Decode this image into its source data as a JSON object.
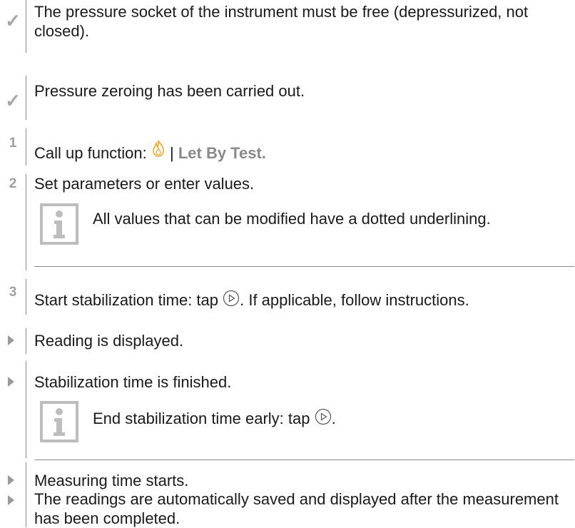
{
  "items": [
    {
      "marker": "✓",
      "text": "The pressure socket of the instrument must be free (depressurized, not closed)."
    },
    {
      "marker": "✓",
      "text": "Pressure zeroing has been carried out."
    },
    {
      "marker": "1",
      "text_before": "Call up function: ",
      "separator": " | ",
      "link": "Let By Test."
    },
    {
      "marker": "2",
      "text": "Set parameters or enter values."
    },
    {
      "marker": "3",
      "text_before": "Start stabilization time: tap ",
      "text_after": ". If applicable, follow instructions."
    },
    {
      "marker": "▶",
      "text": "Reading is displayed."
    },
    {
      "marker": "▶",
      "text": "Stabilization time is finished."
    },
    {
      "marker": "▶",
      "text": "Measuring time starts."
    },
    {
      "marker": "▶",
      "text": "The readings are automatically saved and displayed after the measurement has been completed."
    }
  ],
  "notes": [
    {
      "text": "All values that can be modified have a dotted underlining."
    },
    {
      "text_before": "End stabilization time early: tap ",
      "text_after": "."
    }
  ],
  "colors": {
    "highlight": "#8a8a8a",
    "flame": "#f5a623",
    "rule": "#8a8a8a"
  },
  "icons": [
    "check-icon",
    "flame-icon",
    "play-circle-icon",
    "info-icon",
    "arrow-right-icon"
  ]
}
